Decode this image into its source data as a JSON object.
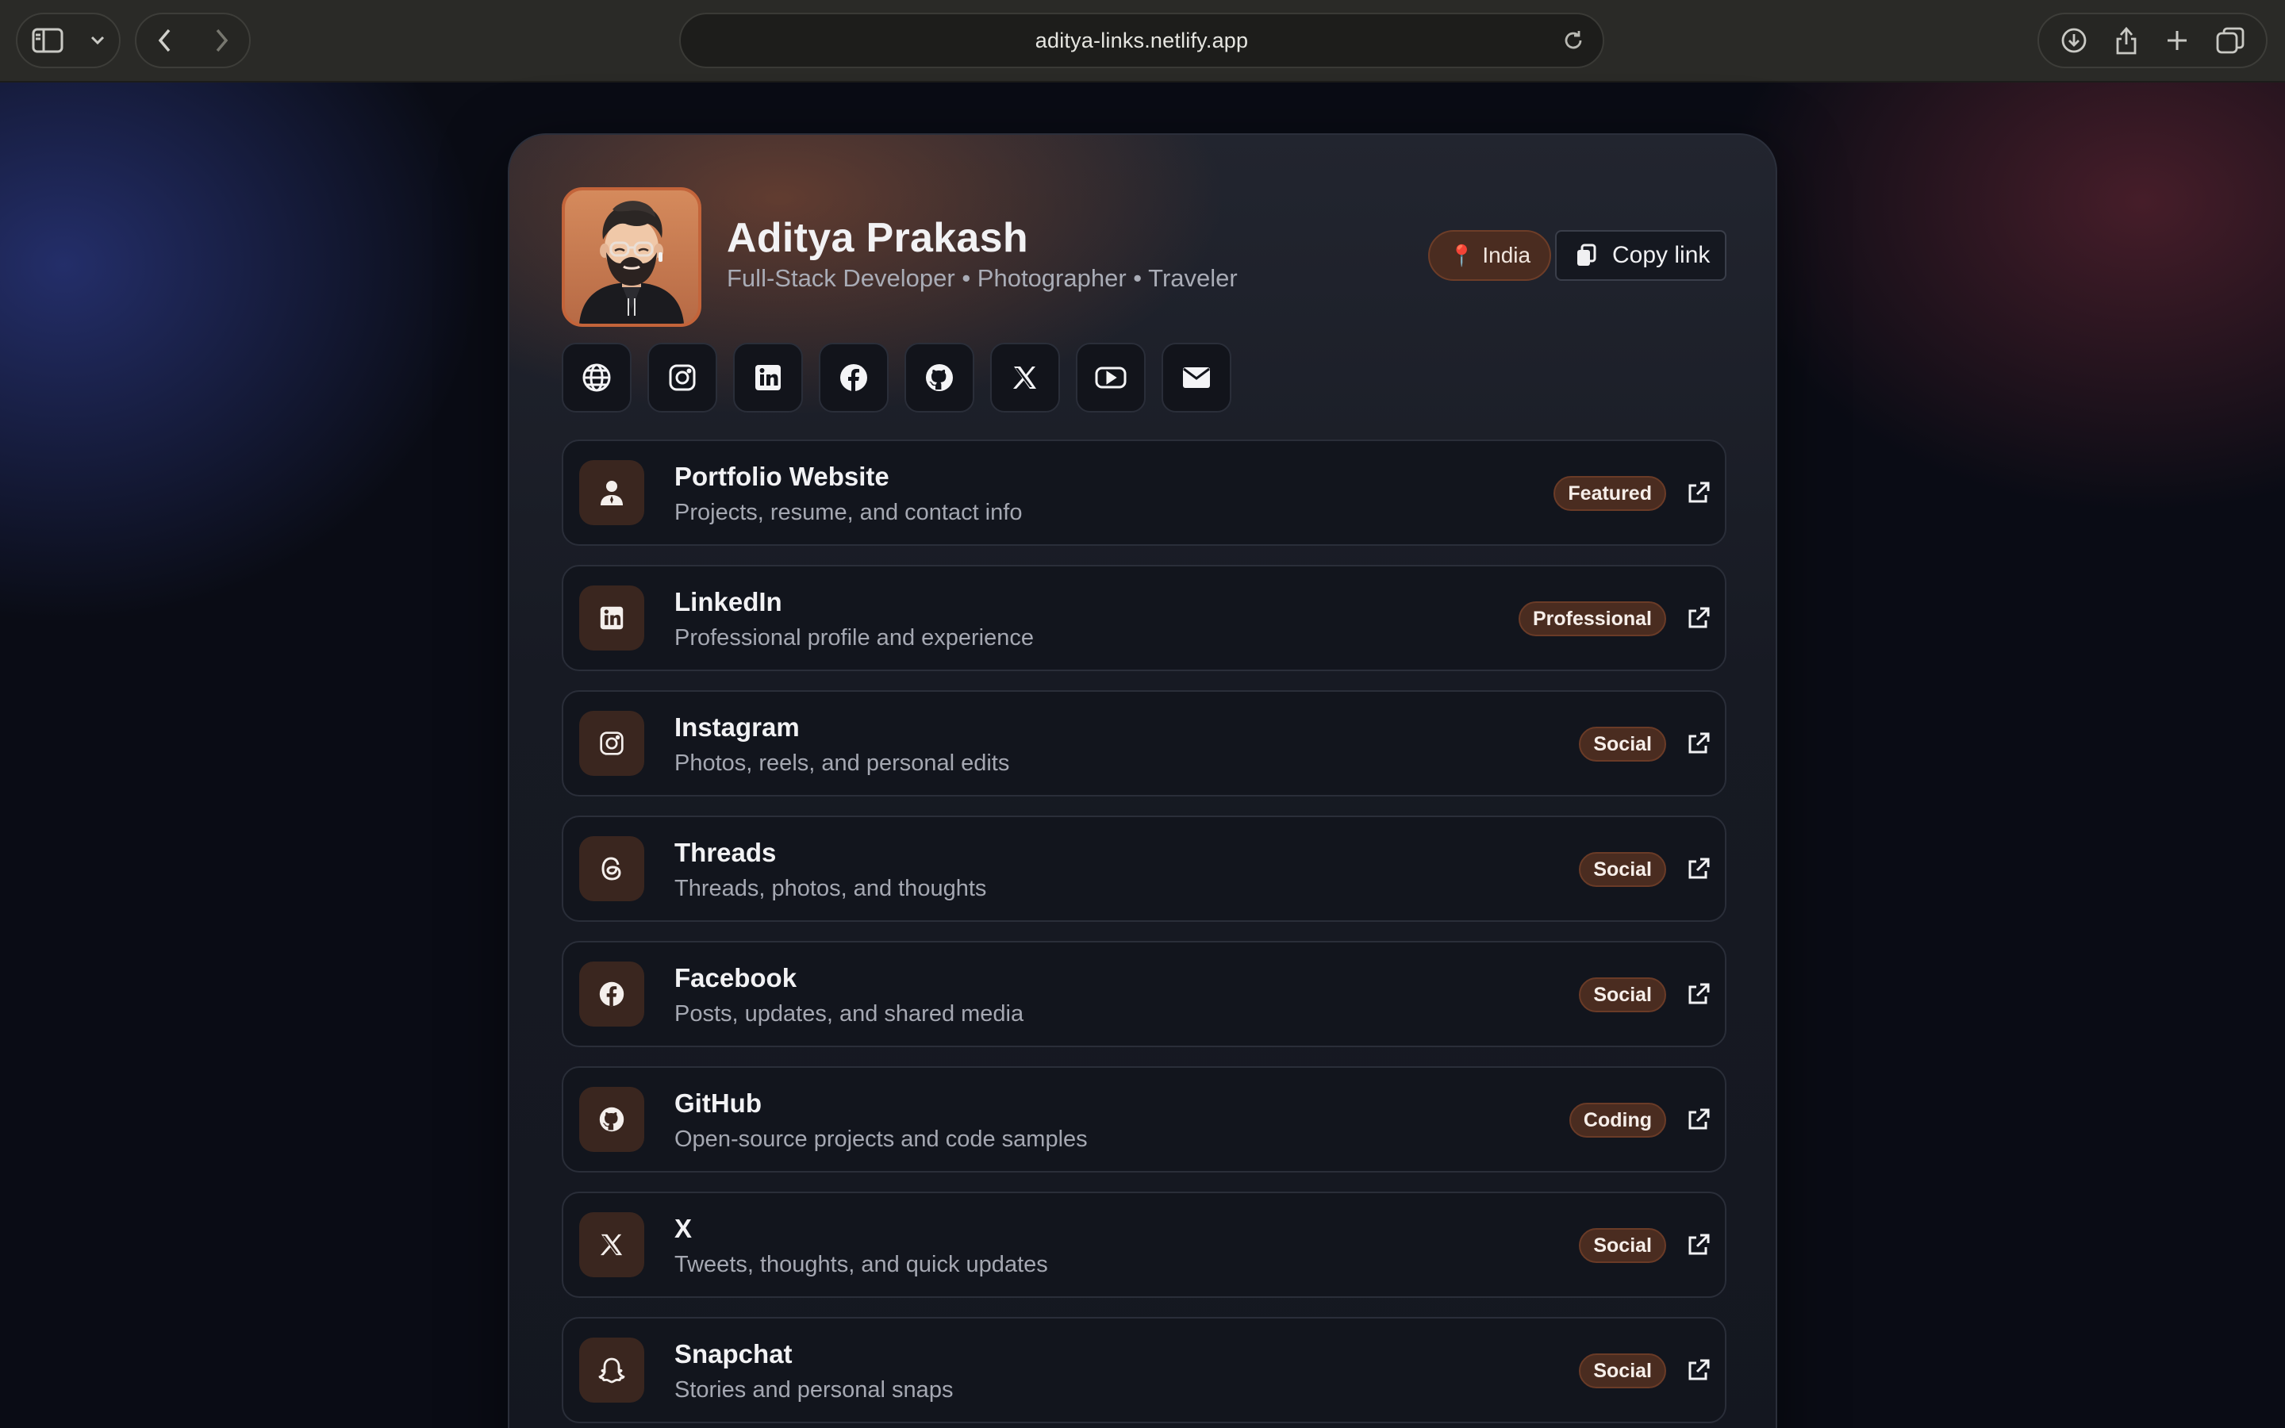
{
  "browser": {
    "url": "aditya-links.netlify.app"
  },
  "profile": {
    "name": "Aditya Prakash",
    "tagline": "Full-Stack Developer • Photographer • Traveler",
    "location_pin": "📍",
    "location": "India",
    "copy_label": "Copy link"
  },
  "social_icons": [
    "globe-icon",
    "instagram-icon",
    "linkedin-icon",
    "facebook-icon",
    "github-icon",
    "x-icon",
    "youtube-icon",
    "mail-icon"
  ],
  "links": [
    {
      "title": "Portfolio Website",
      "desc": "Projects, resume, and contact info",
      "badge": "Featured",
      "icon": "person-icon"
    },
    {
      "title": "LinkedIn",
      "desc": "Professional profile and experience",
      "badge": "Professional",
      "icon": "linkedin-icon"
    },
    {
      "title": "Instagram",
      "desc": "Photos, reels, and personal edits",
      "badge": "Social",
      "icon": "instagram-icon"
    },
    {
      "title": "Threads",
      "desc": "Threads, photos, and thoughts",
      "badge": "Social",
      "icon": "threads-icon"
    },
    {
      "title": "Facebook",
      "desc": "Posts, updates, and shared media",
      "badge": "Social",
      "icon": "facebook-icon"
    },
    {
      "title": "GitHub",
      "desc": "Open-source projects and code samples",
      "badge": "Coding",
      "icon": "github-icon"
    },
    {
      "title": "X",
      "desc": "Tweets, thoughts, and quick updates",
      "badge": "Social",
      "icon": "x-icon"
    },
    {
      "title": "Snapchat",
      "desc": "Stories and personal snaps",
      "badge": "Social",
      "icon": "snapchat-icon"
    }
  ],
  "colors": {
    "accent": "#c3643a",
    "badge_bg": "#4a2c20",
    "card_bg": "#171a23"
  }
}
